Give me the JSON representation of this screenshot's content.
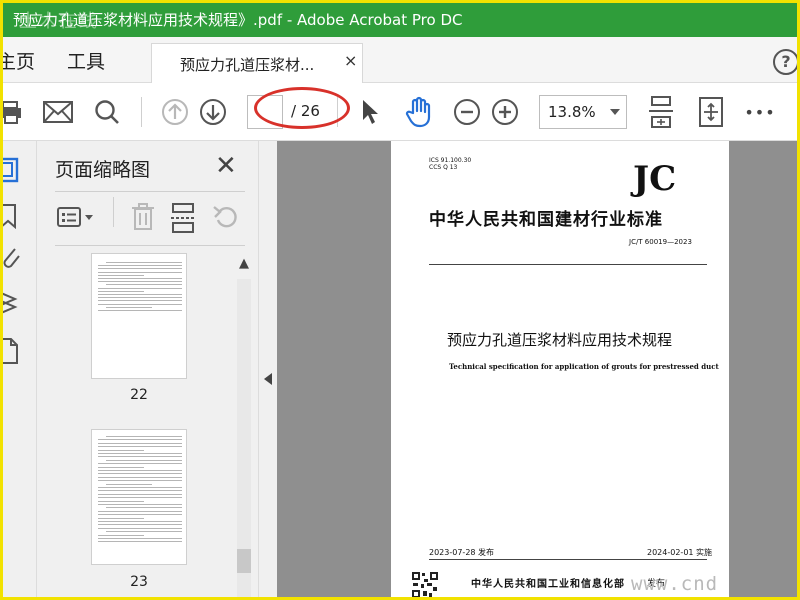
{
  "window": {
    "title": "预应力孔道压浆材料应用技术规程》.pdf - Adobe Acrobat Pro DC",
    "watermark_top": "土木在线"
  },
  "nav": {
    "home": "主页",
    "tools": "工具"
  },
  "doc_tab": {
    "label": "预应力孔道压浆材...",
    "close": "×"
  },
  "help": "?",
  "toolbar": {
    "current_page": "",
    "page_total": "/ 26",
    "zoom": "13.8%",
    "more": "•••"
  },
  "sidebar": {
    "title": "页面缩略图",
    "close": "✕",
    "thumbnails": [
      {
        "page_number": "22"
      },
      {
        "page_number": "23"
      }
    ]
  },
  "document": {
    "ics": "ICS 91.100.30",
    "ccs": "CCS Q 13",
    "code": "JC",
    "industry_title": "中华人民共和国建材行业标准",
    "standard_no": "JC/T 60019—2023",
    "title_cn": "预应力孔道压浆材料应用技术规程",
    "title_en": "Technical specification for application of grouts for prestressed duct",
    "issue_date": "2023-07-28 发布",
    "impl_date": "2024-02-01 实施",
    "issuer": "中华人民共和国工业和信息化部",
    "issue_word": "发布",
    "watermark": "www.cnd"
  },
  "colors": {
    "titlebar": "#2f9d3a",
    "accent_blue": "#2670d6",
    "annotation_red": "#d8312a",
    "frame": "#f2e200"
  }
}
